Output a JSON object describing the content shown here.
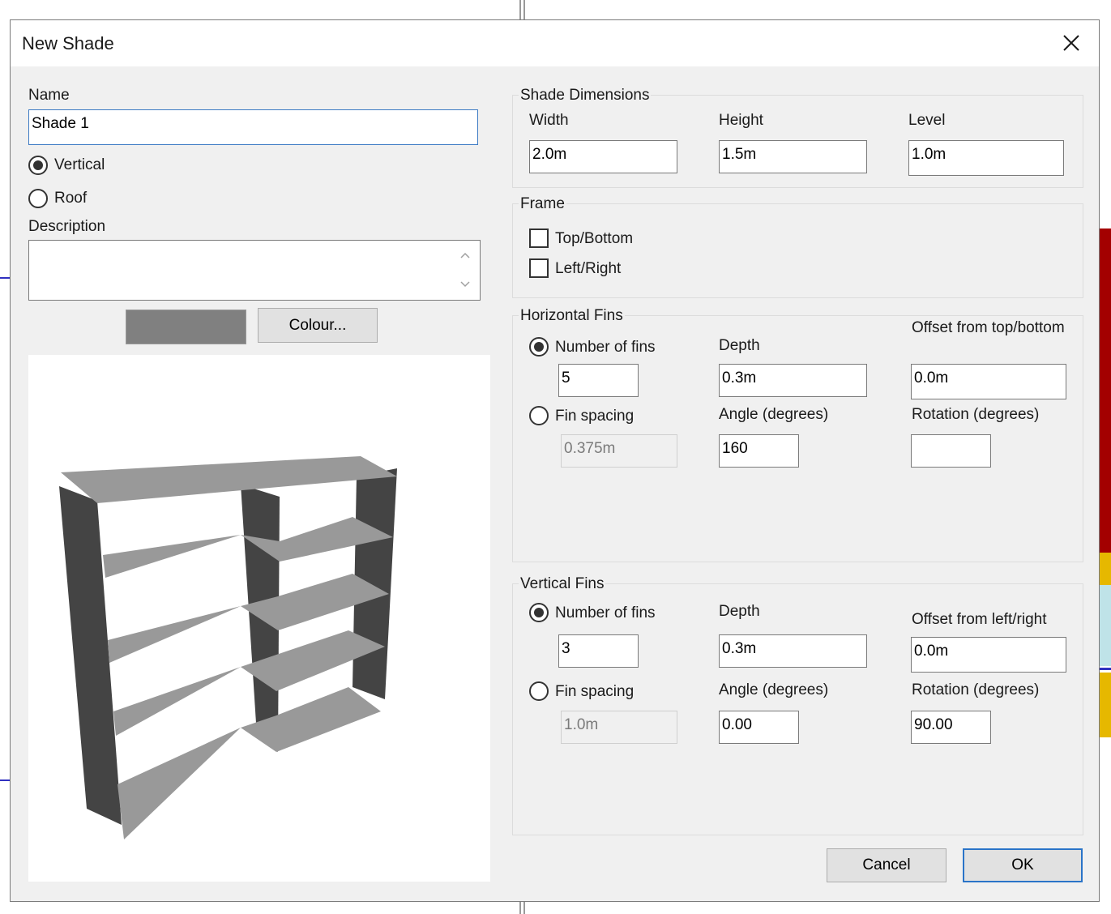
{
  "dialog": {
    "title": "New Shade"
  },
  "left": {
    "name_label": "Name",
    "name_value": "Shade 1",
    "type_vertical": "Vertical",
    "type_roof": "Roof",
    "description_label": "Description",
    "description_value": "",
    "colour_button": "Colour...",
    "swatch_color": "#808080"
  },
  "dimensions": {
    "title": "Shade Dimensions",
    "width_label": "Width",
    "width_value": "2.0m",
    "height_label": "Height",
    "height_value": "1.5m",
    "level_label": "Level",
    "level_value": "1.0m"
  },
  "frame": {
    "title": "Frame",
    "top_bottom": "Top/Bottom",
    "left_right": "Left/Right"
  },
  "horizontal_fins": {
    "title": "Horizontal Fins",
    "number_label": "Number of fins",
    "number_value": "5",
    "spacing_label": "Fin spacing",
    "spacing_value": "0.375m",
    "depth_label": "Depth",
    "depth_value": "0.3m",
    "angle_label": "Angle (degrees)",
    "angle_value": "160",
    "offset_label": "Offset from top/bottom",
    "offset_value": "0.0m",
    "rotation_label": "Rotation (degrees)",
    "rotation_value": ""
  },
  "vertical_fins": {
    "title": "Vertical Fins",
    "number_label": "Number of fins",
    "number_value": "3",
    "spacing_label": "Fin spacing",
    "spacing_value": "1.0m",
    "depth_label": "Depth",
    "depth_value": "0.3m",
    "angle_label": "Angle (degrees)",
    "angle_value": "0.00",
    "offset_label": "Offset from left/right",
    "offset_value": "0.0m",
    "rotation_label": "Rotation (degrees)",
    "rotation_value": "90.00"
  },
  "buttons": {
    "cancel": "Cancel",
    "ok": "OK"
  },
  "colors": {
    "accent": "#2a74c8",
    "fin_light": "#9a9a9a",
    "fin_dark": "#444444"
  }
}
